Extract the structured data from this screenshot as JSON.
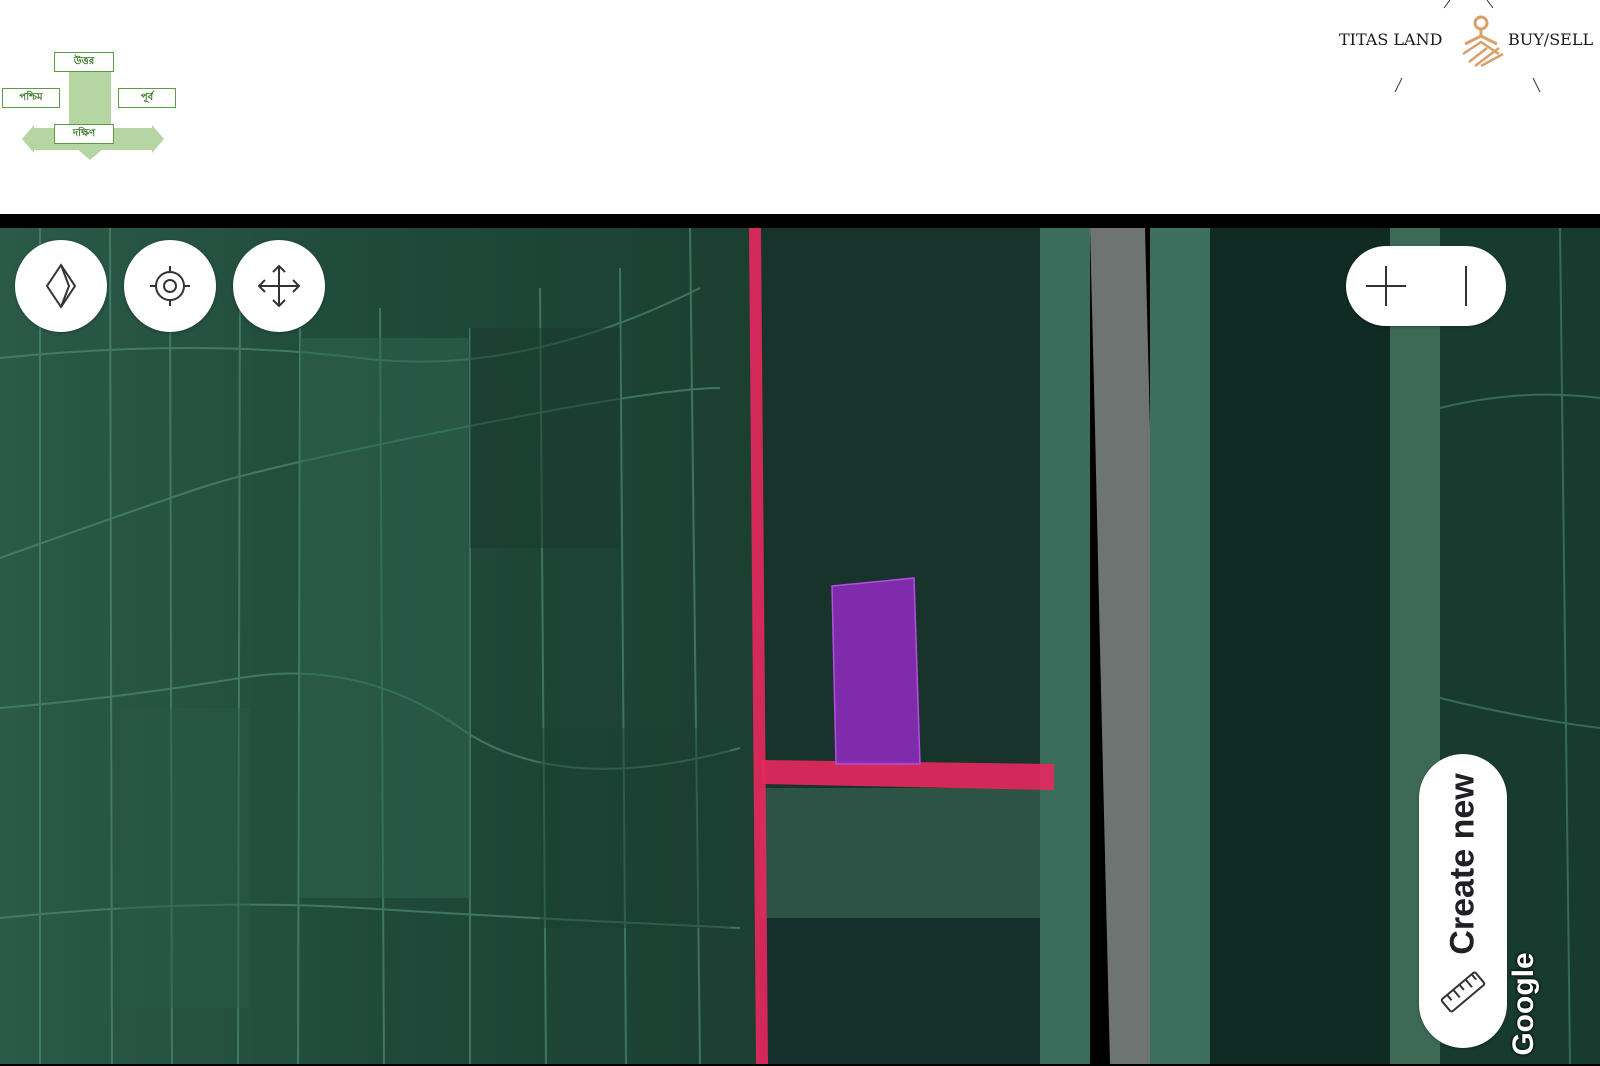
{
  "compass": {
    "north": "উত্তর",
    "south": "দক্ষিণ",
    "west": "পশ্চিম",
    "east": "পূর্ব",
    "color": "#b5d6a2"
  },
  "logo": {
    "left_text": "TITAS LAND",
    "right_text": "BUY/SELL",
    "icon": "house-land-icon",
    "accent": "#d9a06a"
  },
  "map": {
    "type": "satellite",
    "attribution": "Google",
    "road_color": "#e8285e",
    "plot_color": "#8a2bb8"
  },
  "controls": {
    "layers_icon": "diamond-layers-icon",
    "locate_icon": "crosshair-locate-icon",
    "pan_icon": "move-arrows-icon",
    "zoom_in_icon": "plus-icon",
    "zoom_out_icon": "minus-icon"
  },
  "create_new": {
    "label": "Create new",
    "icon": "ruler-icon"
  }
}
